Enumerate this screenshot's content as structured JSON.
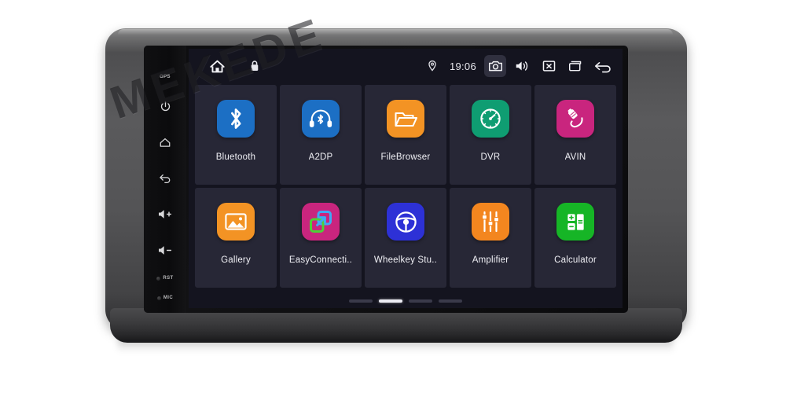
{
  "device": {
    "brand_watermark": "MEKEDE",
    "gps_label": "GPS",
    "hardkeys": [
      {
        "name": "power",
        "label": ""
      },
      {
        "name": "home",
        "label": ""
      },
      {
        "name": "back",
        "label": ""
      },
      {
        "name": "volume-up",
        "label": ""
      },
      {
        "name": "volume-down",
        "label": ""
      },
      {
        "name": "reset",
        "label": "RST"
      },
      {
        "name": "microphone",
        "label": "MIC"
      }
    ]
  },
  "statusbar": {
    "home_icon": "home-icon",
    "lock_icon": "lock-icon",
    "location_icon": "location-pin-icon",
    "clock": "19:06",
    "right_icons": [
      {
        "name": "camera-icon",
        "active": true
      },
      {
        "name": "volume-icon",
        "active": false
      },
      {
        "name": "close-icon",
        "active": false
      },
      {
        "name": "recent-apps-icon",
        "active": false
      },
      {
        "name": "back-arrow-icon",
        "active": false
      }
    ]
  },
  "apps": {
    "row1": [
      {
        "label": "Bluetooth",
        "icon": "bluetooth-icon",
        "color": "#1c6fc4"
      },
      {
        "label": "A2DP",
        "icon": "a2dp-headphone-icon",
        "color": "#1c6fc4"
      },
      {
        "label": "FileBrowser",
        "icon": "folder-icon",
        "color": "#f39324"
      },
      {
        "label": "DVR",
        "icon": "speedometer-icon",
        "color": "#0f9d72"
      },
      {
        "label": "AVIN",
        "icon": "audio-jack-icon",
        "color": "#c9257e"
      }
    ],
    "row2": [
      {
        "label": "Gallery",
        "icon": "photo-icon",
        "color": "#f39324"
      },
      {
        "label": "EasyConnecti..",
        "icon": "easyconnect-icon",
        "color": "#c9257e"
      },
      {
        "label": "Wheelkey Stu..",
        "icon": "steering-wheel-icon",
        "color": "#2d31d6"
      },
      {
        "label": "Amplifier",
        "icon": "equalizer-icon",
        "color": "#f3861f"
      },
      {
        "label": "Calculator",
        "icon": "calculator-icon",
        "color": "#16b526"
      }
    ]
  },
  "pager": {
    "pages": 4,
    "active_index": 1
  },
  "colors": {
    "screen_bg": "#14141f",
    "tile_bg": "#272736",
    "text": "#f0f0f5",
    "bezel": "#545456"
  }
}
